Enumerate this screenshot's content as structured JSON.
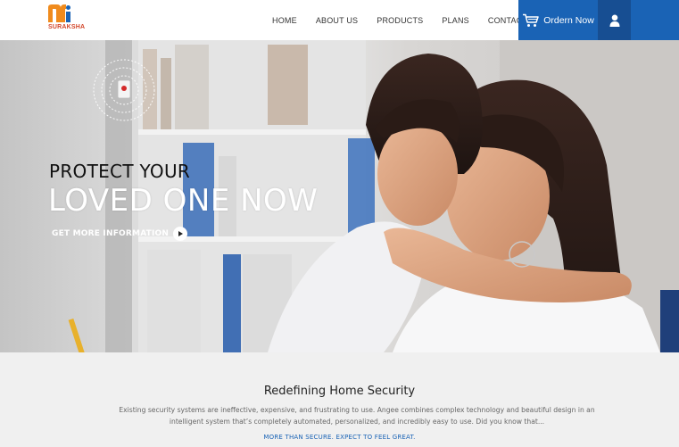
{
  "brand": {
    "name": "SURAKSHA",
    "colors": {
      "orange": "#f08b1d",
      "red": "#d2462a",
      "blue": "#1a63b5",
      "dark_blue": "#174e92"
    }
  },
  "nav": {
    "items": [
      {
        "label": "HOME"
      },
      {
        "label": "ABOUT US"
      },
      {
        "label": "PRODUCTS"
      },
      {
        "label": "PLANS"
      },
      {
        "label": "CONTACT"
      }
    ],
    "order_button": {
      "label": "Ordern Now",
      "icon": "cart-icon"
    },
    "user_button": {
      "icon": "user-icon"
    }
  },
  "hero": {
    "line1": "PROTECT YOUR",
    "line2": "LOVED ONE NOW",
    "cta_label": "GET MORE INFORMATION",
    "cta_icon": "play-icon",
    "device_icon": "alarm-device-icon"
  },
  "intro": {
    "title": "Redefining Home Security",
    "body": "Existing security systems are ineffective, expensive, and frustrating to use. Angee combines complex technology and beautiful design in an intelligent system that’s completely automated, personalized, and incredibly easy to use. Did you know that...",
    "tagline": "MORE THAN SECURE. EXPECT TO FEEL GREAT."
  }
}
